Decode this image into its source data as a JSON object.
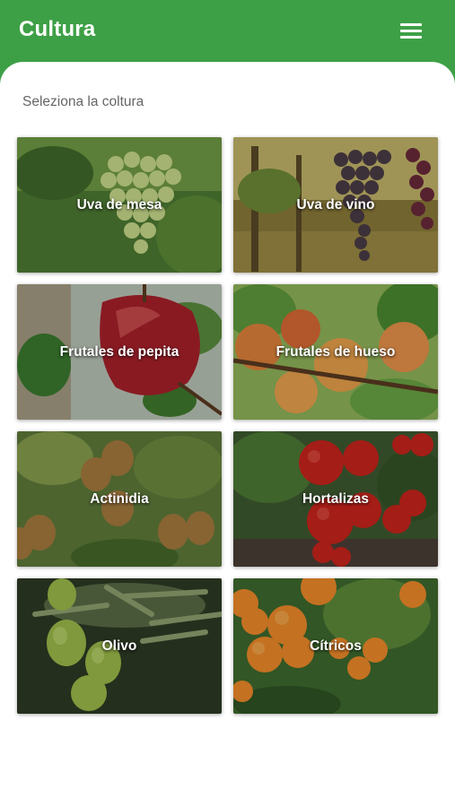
{
  "appbar": {
    "title": "Cultura",
    "menu_icon": "hamburger-menu-icon",
    "color": "#3ea046"
  },
  "main": {
    "subtitle": "Seleziona la coltura",
    "crops": [
      {
        "label": "Uva de mesa",
        "image": "table-grapes"
      },
      {
        "label": "Uva de vino",
        "image": "wine-grapes"
      },
      {
        "label": "Frutales de pepita",
        "image": "apple"
      },
      {
        "label": "Frutales de hueso",
        "image": "peaches"
      },
      {
        "label": "Actinidia",
        "image": "kiwi"
      },
      {
        "label": "Hortalizas",
        "image": "tomatoes"
      },
      {
        "label": "Olivo",
        "image": "olives"
      },
      {
        "label": "Cítricos",
        "image": "oranges"
      }
    ]
  }
}
